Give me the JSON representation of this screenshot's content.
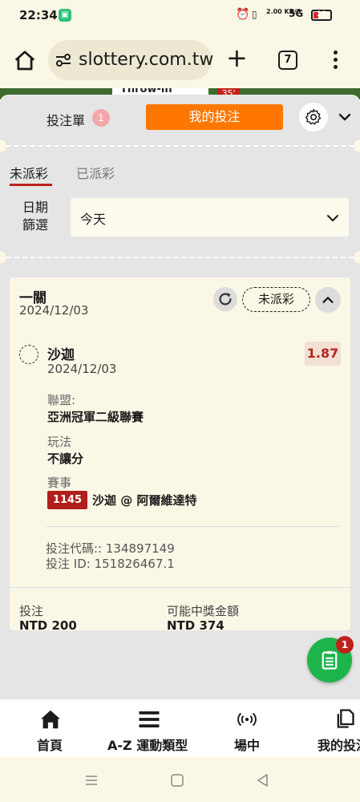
{
  "status_bar": {
    "time": "22:34",
    "network_speed": "2.00 KB/S",
    "signal": "5G",
    "battery": "18",
    "battery_level_percent": 18
  },
  "browser": {
    "url": "slottery.com.tw",
    "tab_count": "7"
  },
  "peek": {
    "text": "Throw-in",
    "badge": "35'"
  },
  "slip": {
    "label": "投注單",
    "count": "1",
    "my_bets_button": "我的投注"
  },
  "tabs": {
    "unsettled": "未派彩",
    "settled": "已派彩"
  },
  "date_filter": {
    "label": "日期篩選",
    "value": "今天"
  },
  "bet": {
    "type": "一關",
    "date": "2024/12/03",
    "status": "未派彩",
    "selection": {
      "team": "沙迦",
      "date": "2024/12/03",
      "odds": "1.87"
    },
    "league_label": "聯盟:",
    "league": "亞洲冠軍二級聯賽",
    "market_label": "玩法",
    "market": "不讓分",
    "event_label": "賽事",
    "event_id": "1145",
    "event_name": "沙迦 @ 阿爾維達特",
    "bet_code": "投注代碼:: 134897149",
    "bet_id": "投注 ID: 151826467.1"
  },
  "summary": {
    "stake_label": "投注",
    "stake": "NTD 200",
    "payout_label": "可能中獎金額",
    "payout": "NTD 374"
  },
  "fab": {
    "badge": "1"
  },
  "bottom_nav": {
    "home": "首頁",
    "sports": "A-Z 運動類型",
    "live": "場中",
    "my_bets": "我的投注"
  },
  "colors": {
    "accent": "#ff7700",
    "brand_red": "#c0221b",
    "fab_green": "#1db54a",
    "odds_color": "#b3261e"
  }
}
